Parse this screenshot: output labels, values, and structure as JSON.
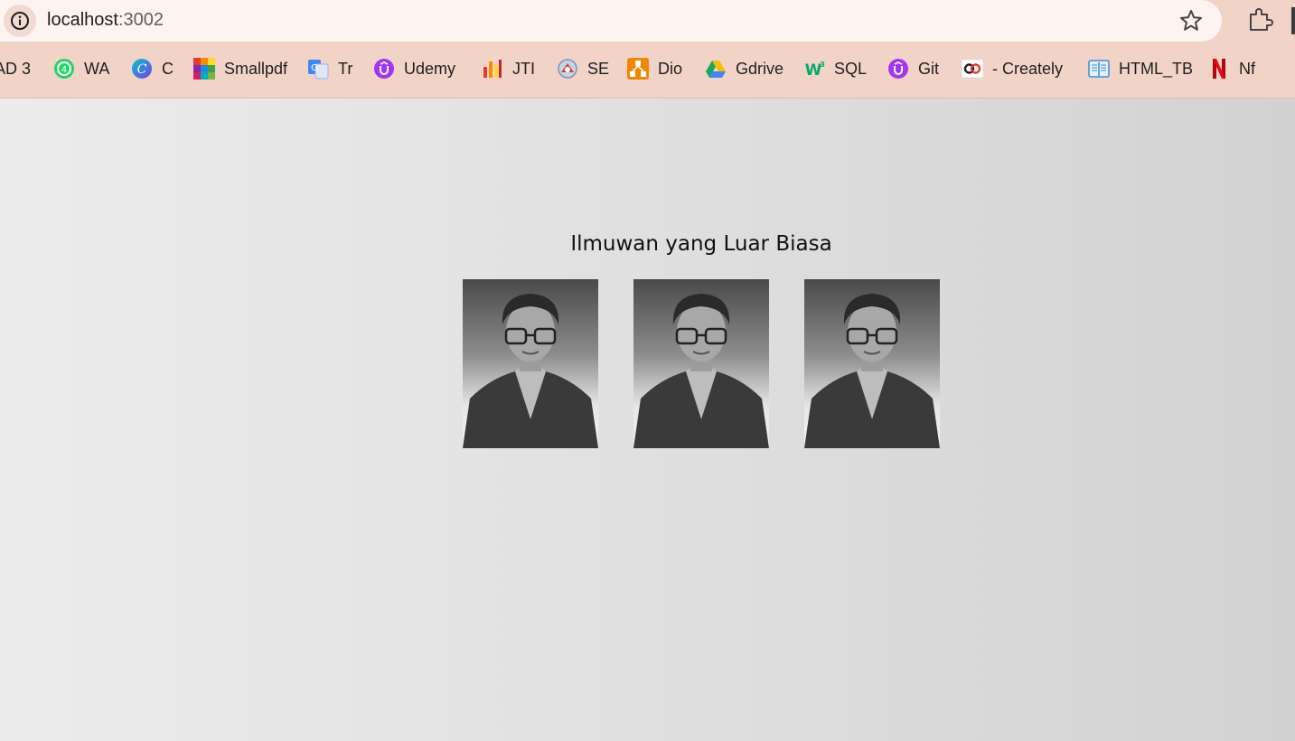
{
  "browser": {
    "url_host": "localhost",
    "url_port": ":3002",
    "icons": {
      "site_info": "info-icon",
      "bookmark": "star-icon",
      "extensions": "puzzle-icon"
    }
  },
  "bookmarks": [
    {
      "label": "AD 3",
      "icon": "none"
    },
    {
      "label": "WA",
      "icon": "whatsapp-icon",
      "color": "#25d366"
    },
    {
      "label": "C",
      "icon": "canva-icon",
      "color": "#7b3fe4"
    },
    {
      "label": "Smallpdf",
      "icon": "smallpdf-icon",
      "color": "#e53935"
    },
    {
      "label": "Tr",
      "icon": "translate-icon",
      "color": "#4285f4"
    },
    {
      "label": "Udemy",
      "icon": "udemy-icon",
      "color": "#a435f0"
    },
    {
      "label": "JTI",
      "icon": "jti-icon",
      "color": "#e53935"
    },
    {
      "label": "SE",
      "icon": "se-icon",
      "color": "#d04437"
    },
    {
      "label": "Dio",
      "icon": "drawio-icon",
      "color": "#f08705"
    },
    {
      "label": "Gdrive",
      "icon": "gdrive-icon",
      "color": "#1fa463"
    },
    {
      "label": "SQL",
      "icon": "w3schools-icon",
      "color": "#04aa6d"
    },
    {
      "label": "Git",
      "icon": "udemy-icon",
      "color": "#a435f0"
    },
    {
      "label": "- Creately",
      "icon": "creately-icon",
      "color": "#e53935"
    },
    {
      "label": "HTML_TB",
      "icon": "book-icon",
      "color": "#3b8fd0"
    },
    {
      "label": "Nf",
      "icon": "netflix-icon",
      "color": "#e50914"
    }
  ],
  "page": {
    "title": "Ilmuwan yang Luar Biasa",
    "photos": [
      {
        "subject": "scientist-portrait"
      },
      {
        "subject": "scientist-portrait"
      },
      {
        "subject": "scientist-portrait"
      }
    ]
  }
}
